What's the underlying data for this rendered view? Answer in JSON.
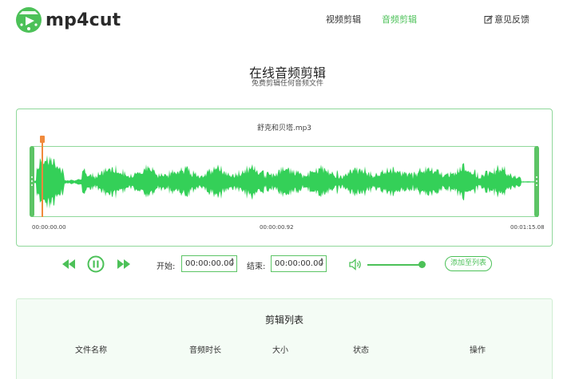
{
  "header": {
    "logo_text": "mp4cut",
    "nav": [
      {
        "label": "视频剪辑",
        "active": false
      },
      {
        "label": "音频剪辑",
        "active": true
      }
    ],
    "feedback_label": "意见反馈"
  },
  "page": {
    "title": "在线音频剪辑",
    "subtitle": "免费剪辑任何音频文件"
  },
  "editor": {
    "file_name": "舒克和贝塔.mp3",
    "time_labels": [
      "00:00:00.00",
      "00:00:00.92",
      "00:01:15.08"
    ],
    "playhead_position": 0.015,
    "wave_color": "#34d058"
  },
  "controls": {
    "start_label": "开始:",
    "start_value": "00:00:00.00",
    "end_label": "结束:",
    "end_value": "00:00:00.00",
    "volume_level": 0.95,
    "add_button_label": "添加至列表",
    "icons": [
      "rewind-icon",
      "pause-icon",
      "fast-forward-icon",
      "volume-icon"
    ]
  },
  "clip_list": {
    "title": "剪辑列表",
    "columns": [
      "文件名称",
      "音频时长",
      "大小",
      "状态",
      "操作"
    ]
  },
  "colors": {
    "accent": "#4cc158",
    "playhead": "#f08a3c",
    "card_border": "#8fd89a"
  }
}
